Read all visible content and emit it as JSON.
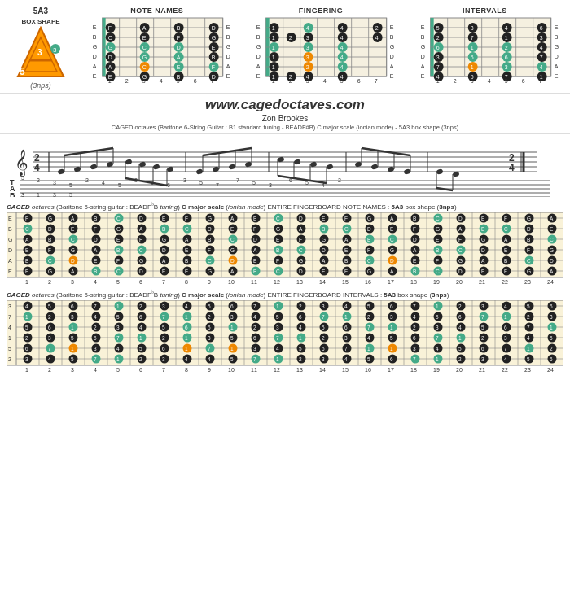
{
  "header": {
    "box_shape_title": "5A3",
    "box_shape_subtitle": "BOX SHAPE",
    "box_shape_label": "(3nps)",
    "diagram_labels": [
      "NOTE NAMES",
      "FINGERING",
      "INTERVALS"
    ],
    "fret_numbers": [
      "1",
      "2",
      "3",
      "4",
      "5",
      "6",
      "7"
    ]
  },
  "middle": {
    "url": "www.cagedoctaves.com",
    "author": "Zon Brookes",
    "description": "CAGED octaves (Baritone 6-String Guitar : B1 standard tuning - BEADF#B) C major scale (ionian mode) - 5A3 box shape (3nps)"
  },
  "fingerboard_notes": {
    "title_notes": "CAGED octaves (Baritone 6-string guitar : BEADF♭B tuning) C major scale (ionian mode) ENTIRE FINGERBOARD NOTE NAMES : 5A3 box shape (3nps)",
    "title_intervals": "CAGED octaves (Baritone 6-string guitar : BEADF♭B tuning) C major scale (ionian mode) ENTIRE FINGERBOARD INTERVALS : 5A3 box shape (3nps)",
    "fret_numbers": [
      "1",
      "2",
      "3",
      "4",
      "5",
      "6",
      "7",
      "8",
      "9",
      "10",
      "11",
      "12",
      "13",
      "14",
      "15",
      "16",
      "17",
      "18",
      "19",
      "20",
      "21",
      "22",
      "23",
      "24"
    ],
    "strings": [
      "E",
      "B",
      "G",
      "D",
      "A",
      "E"
    ],
    "caged_label": "CAGED"
  }
}
